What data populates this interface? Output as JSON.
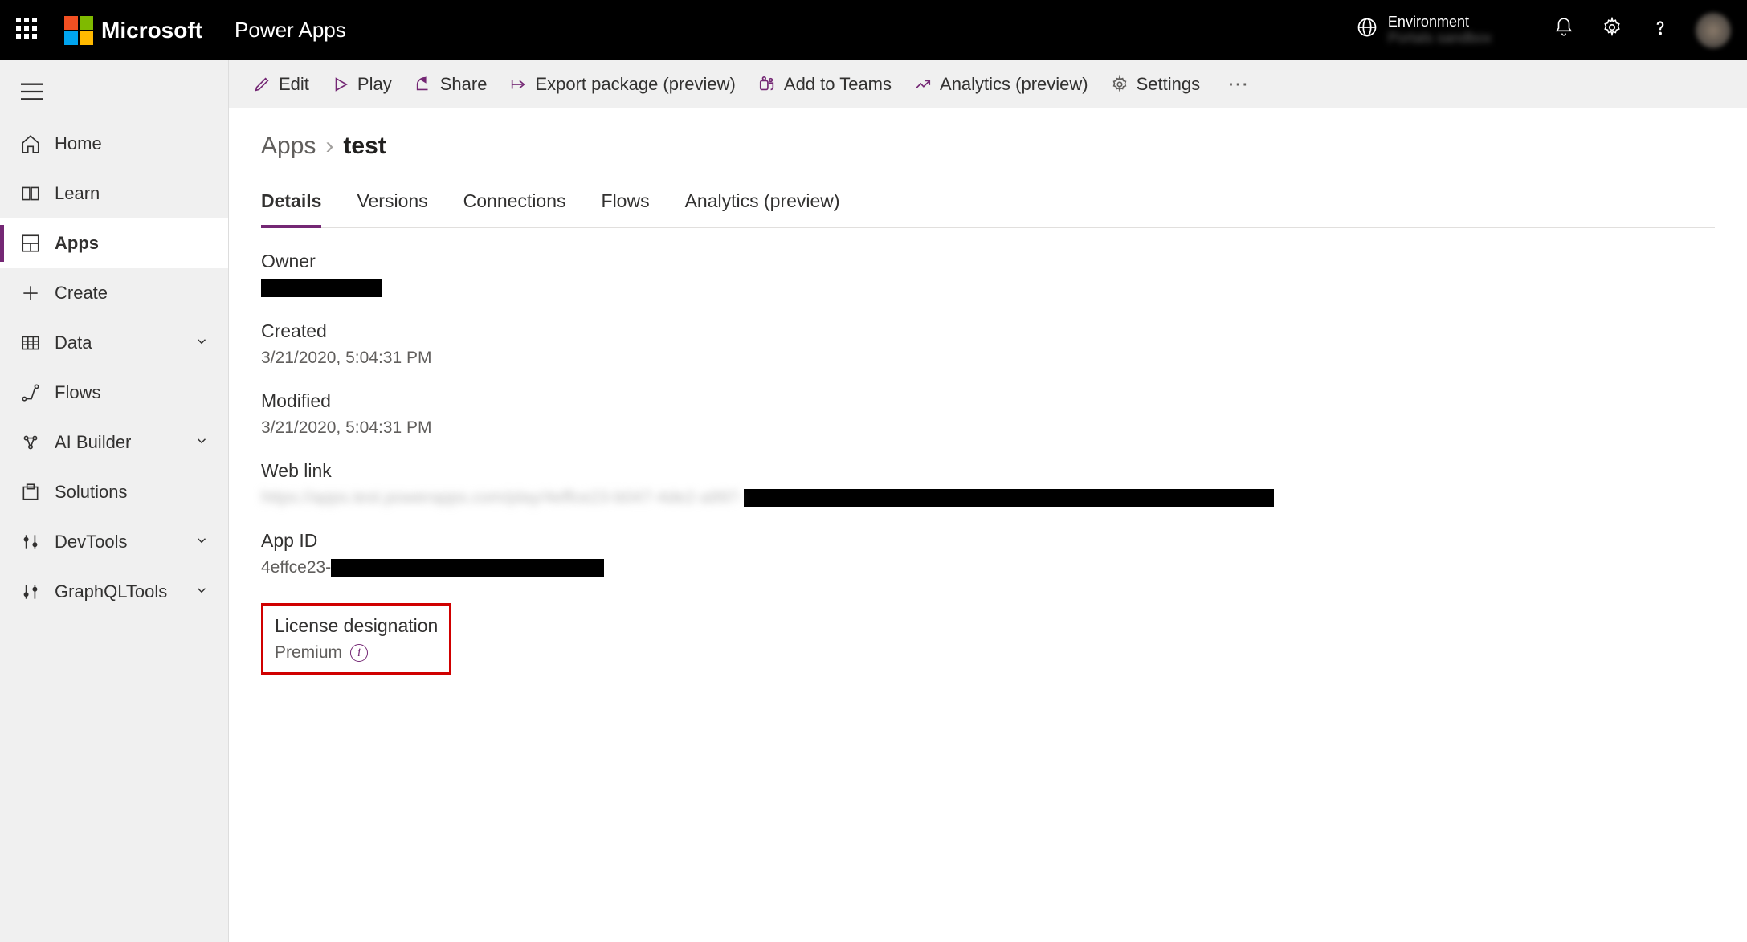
{
  "topbar": {
    "brand": "Microsoft",
    "product": "Power Apps",
    "environment_label": "Environment",
    "environment_name": "Portals sandbox"
  },
  "sidebar": {
    "items": [
      {
        "label": "Home"
      },
      {
        "label": "Learn"
      },
      {
        "label": "Apps"
      },
      {
        "label": "Create"
      },
      {
        "label": "Data"
      },
      {
        "label": "Flows"
      },
      {
        "label": "AI Builder"
      },
      {
        "label": "Solutions"
      },
      {
        "label": "DevTools"
      },
      {
        "label": "GraphQLTools"
      }
    ]
  },
  "commandbar": {
    "edit": "Edit",
    "play": "Play",
    "share": "Share",
    "export": "Export package (preview)",
    "teams": "Add to Teams",
    "analytics": "Analytics (preview)",
    "settings": "Settings"
  },
  "breadcrumb": {
    "root": "Apps",
    "current": "test"
  },
  "tabs": [
    {
      "label": "Details"
    },
    {
      "label": "Versions"
    },
    {
      "label": "Connections"
    },
    {
      "label": "Flows"
    },
    {
      "label": "Analytics (preview)"
    }
  ],
  "details": {
    "owner_label": "Owner",
    "created_label": "Created",
    "created_value": "3/21/2020, 5:04:31 PM",
    "modified_label": "Modified",
    "modified_value": "3/21/2020, 5:04:31 PM",
    "weblink_label": "Web link",
    "weblink_prefix": "https://apps.test.powerapps.com/play/4effce23-b047-4de2-a997-",
    "appid_label": "App ID",
    "appid_prefix": "4effce23-",
    "license_label": "License designation",
    "license_value": "Premium"
  }
}
